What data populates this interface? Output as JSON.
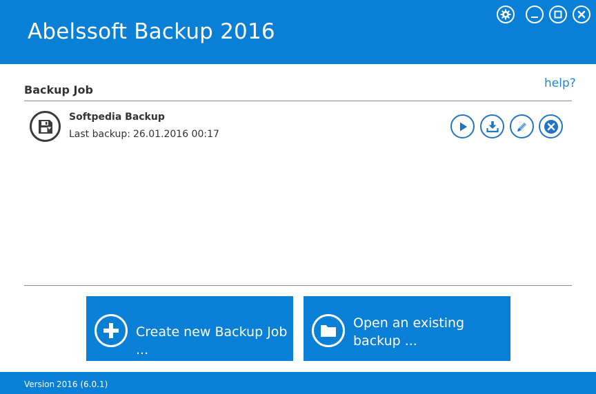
{
  "app": {
    "title": "Abelssoft Backup 2016"
  },
  "window_controls": {
    "settings": "gear-icon",
    "minimize": "minimize-icon",
    "maximize": "maximize-icon",
    "close": "close-icon"
  },
  "main": {
    "section_title": "Backup Job",
    "help_label": "help?"
  },
  "backup_jobs": [
    {
      "name": "Softpedia Backup",
      "last_backup_label": "Last backup:",
      "last_backup_value": "26.01.2016 00:17",
      "icon": "save-disk-icon",
      "actions": [
        "play-icon",
        "restore-download-icon",
        "edit-pencil-icon",
        "delete-x-icon"
      ]
    }
  ],
  "bottom_actions": {
    "create_label": "Create new Backup Job ...",
    "open_label_line1": "Open an existing",
    "open_label_line2": "backup ..."
  },
  "footer": {
    "version_label": "Version",
    "version_value": "2016 (6.0.1)"
  },
  "colors": {
    "brand_blue": "#0a7fd6",
    "action_blue": "#1f74c4",
    "help_blue": "#1a8ad6"
  }
}
